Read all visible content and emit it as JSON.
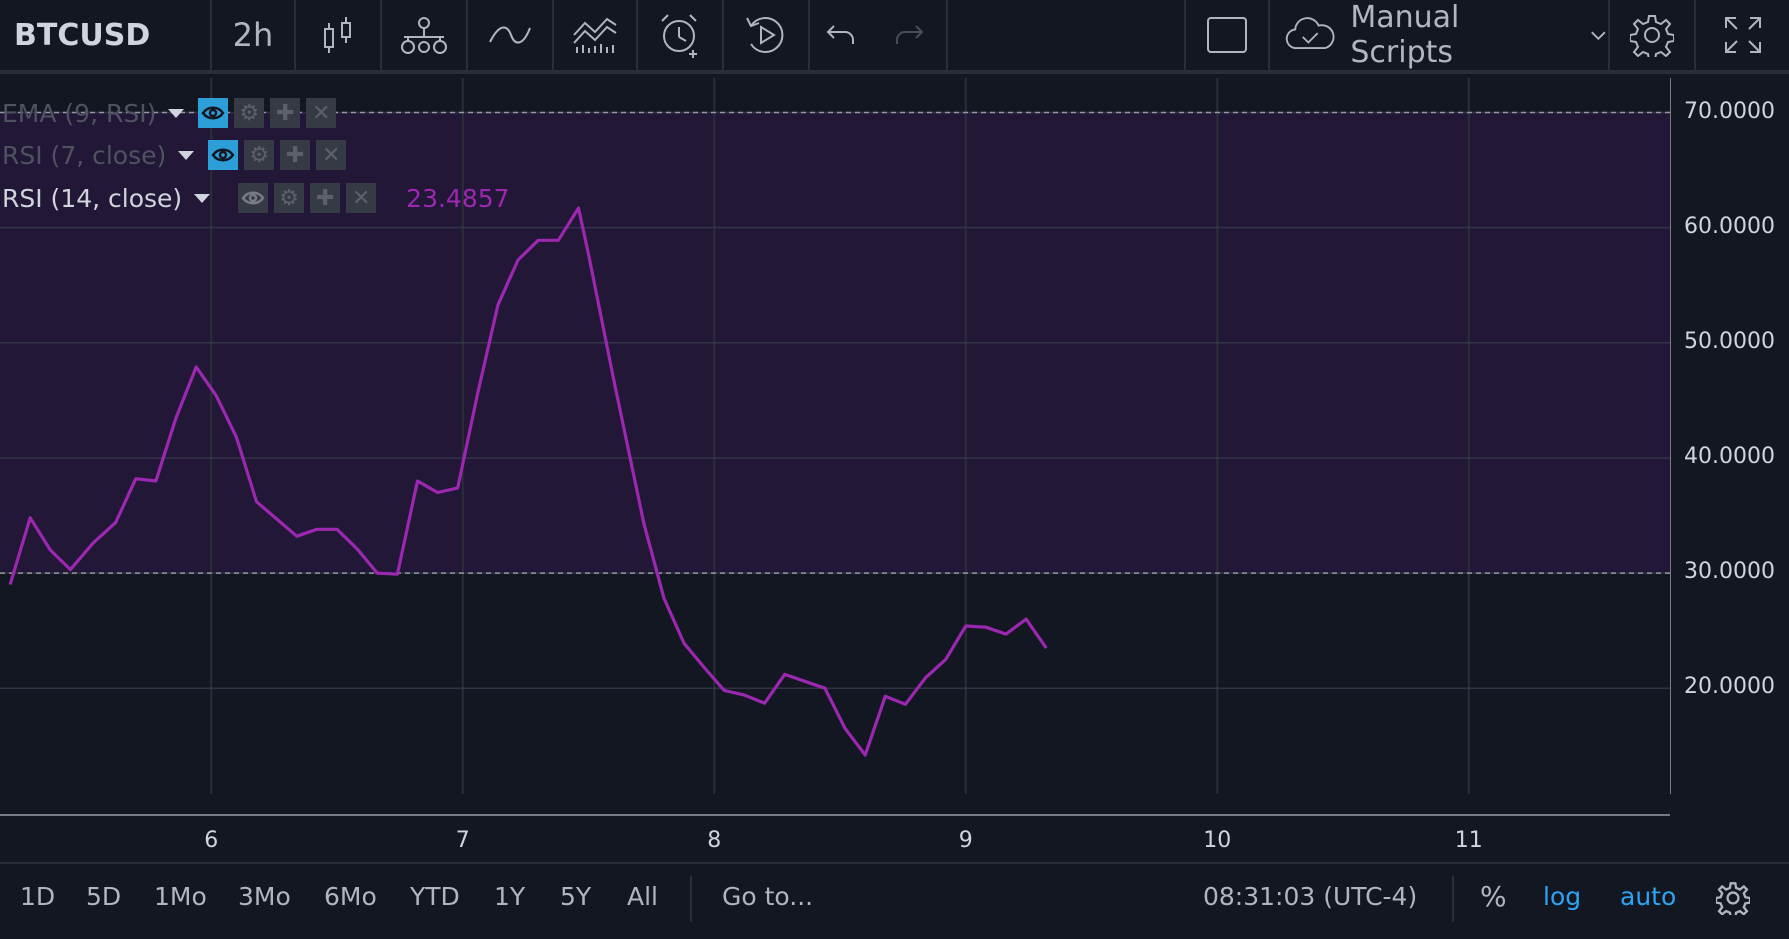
{
  "toolbar": {
    "symbol": "BTCUSD",
    "interval": "2h",
    "layout_button": "Manual Scripts",
    "icons": [
      "candles-icon",
      "compare-icon",
      "indicators-icon",
      "financials-icon",
      "alert-icon",
      "replay-icon",
      "undo-icon",
      "redo-icon",
      "layout-square-icon",
      "cloud-icon",
      "chevron-down-icon",
      "gear-icon",
      "fullscreen-icon"
    ]
  },
  "legend": [
    {
      "label": "EMA (9, RSI)",
      "value": "",
      "visible": true
    },
    {
      "label": "RSI (7, close)",
      "value": "",
      "visible": true
    },
    {
      "label": "RSI (14, close)",
      "value": "23.4857",
      "visible": false
    }
  ],
  "colors": {
    "background": "#131722",
    "band": "#221736",
    "rsi_line": "#9c27b0",
    "grid": "#2a2e39",
    "accent_blue": "#2ea3f2"
  },
  "bottombar": {
    "ranges": [
      "1D",
      "5D",
      "1Mo",
      "3Mo",
      "6Mo",
      "YTD",
      "1Y",
      "5Y",
      "All"
    ],
    "goto": "Go to...",
    "time": "08:31:03 (UTC-4)",
    "percent": "%",
    "log": "log",
    "auto": "auto"
  },
  "chart_data": {
    "type": "line",
    "series": [
      {
        "name": "RSI (14, close)",
        "x": [
          5.2,
          5.28,
          5.36,
          5.44,
          5.53,
          5.62,
          5.7,
          5.78,
          5.86,
          5.94,
          6.02,
          6.1,
          6.18,
          6.26,
          6.34,
          6.42,
          6.5,
          6.58,
          6.66,
          6.74,
          6.82,
          6.9,
          6.98,
          7.06,
          7.14,
          7.22,
          7.3,
          7.38,
          7.46,
          7.5,
          7.6,
          7.72,
          7.8,
          7.88,
          7.96,
          8.04,
          8.12,
          8.2,
          8.28,
          8.36,
          8.44,
          8.52,
          8.6,
          8.68,
          8.76,
          8.84,
          8.92,
          9.0,
          9.08,
          9.16,
          9.24,
          9.32
        ],
        "y": [
          29.0,
          34.8,
          32.0,
          30.3,
          32.6,
          34.4,
          38.2,
          38.0,
          43.5,
          47.9,
          45.4,
          41.8,
          36.2,
          34.7,
          33.2,
          33.8,
          33.8,
          32.1,
          30.0,
          29.9,
          38.0,
          37.0,
          37.4,
          45.7,
          53.3,
          57.2,
          58.9,
          58.9,
          61.7,
          57.7,
          46.8,
          34.3,
          27.8,
          23.9,
          21.8,
          19.8,
          19.4,
          18.7,
          21.2,
          20.6,
          20.0,
          16.5,
          14.2,
          19.3,
          18.6,
          20.9,
          22.5,
          25.4,
          25.3,
          24.7,
          26.0,
          23.4857
        ]
      }
    ],
    "bands": {
      "upper": 70,
      "lower": 30
    },
    "x_ticks": [
      "6",
      "7",
      "8",
      "9",
      "10",
      "11"
    ],
    "x_tick_values": [
      6,
      7,
      8,
      9,
      10,
      11
    ],
    "y_ticks": [
      "70.0000",
      "60.0000",
      "50.0000",
      "40.0000",
      "30.0000",
      "20.0000"
    ],
    "y_tick_values": [
      70,
      60,
      50,
      40,
      30,
      20
    ],
    "xlim": [
      5.16,
      11.8
    ],
    "ylim": [
      8.9,
      73.0
    ],
    "grid": true
  }
}
